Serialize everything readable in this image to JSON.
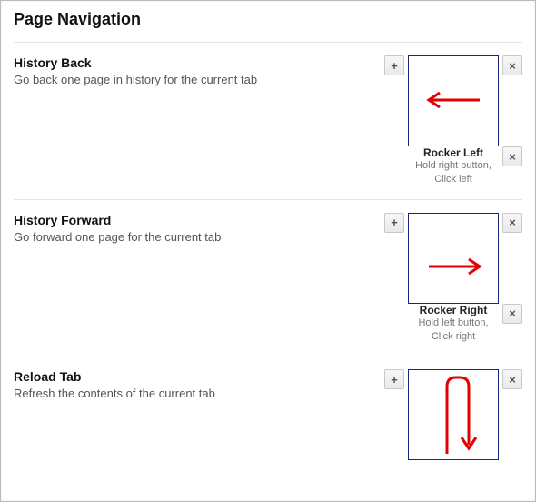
{
  "section": {
    "title": "Page Navigation"
  },
  "buttons": {
    "plus": "+",
    "x": "×"
  },
  "gestures": [
    {
      "title": "History Back",
      "desc": "Go back one page in history for the current tab",
      "shape": "arrow-left",
      "secondary": {
        "name": "Rocker Left",
        "desc": "Hold right button, Click left"
      }
    },
    {
      "title": "History Forward",
      "desc": "Go forward one page for the current tab",
      "shape": "arrow-right",
      "secondary": {
        "name": "Rocker Right",
        "desc": "Hold left button, Click right"
      }
    },
    {
      "title": "Reload Tab",
      "desc": "Refresh the contents of the current tab",
      "shape": "u-turn-down",
      "secondary": null
    }
  ]
}
